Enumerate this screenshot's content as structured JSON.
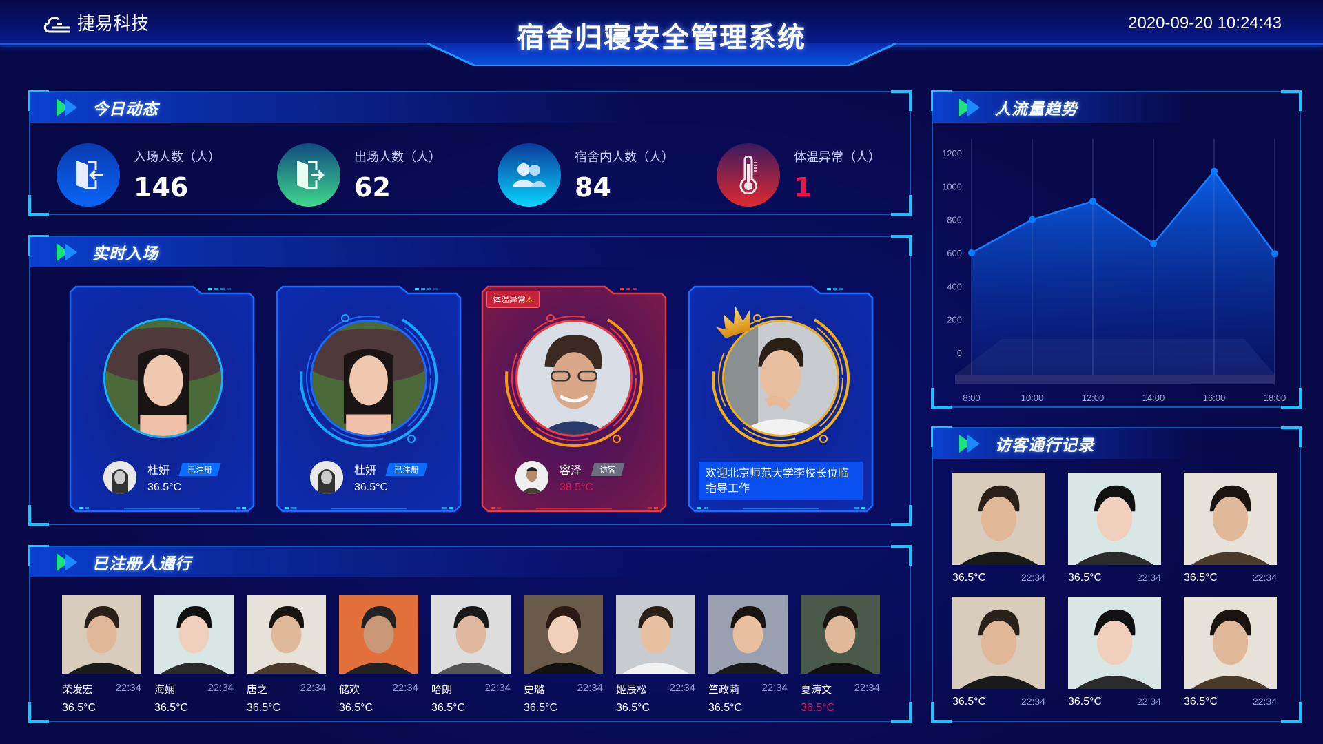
{
  "header": {
    "logo_text": "捷易科技",
    "title": "宿舍归寝安全管理系统",
    "datetime": "2020-09-20 10:24:43"
  },
  "colors": {
    "accent": "#0a5cf0",
    "corner": "#12c6ff",
    "alert": "#e8194a",
    "registered_badge": "#0a6cff",
    "visitor_badge": "#6b6e80",
    "gold": "#f5b10f"
  },
  "today": {
    "title": "今日动态",
    "stats": [
      {
        "label": "入场人数（人）",
        "value": "146",
        "icon": "door-enter-icon"
      },
      {
        "label": "出场人数（人）",
        "value": "62",
        "icon": "door-exit-icon"
      },
      {
        "label": "宿舍内人数（人）",
        "value": "84",
        "icon": "users-icon"
      },
      {
        "label": "体温异常（人）",
        "value": "1",
        "icon": "thermometer-icon"
      }
    ]
  },
  "realtime": {
    "title": "实时入场",
    "cards": [
      {
        "name": "杜妍",
        "badge": "已注册",
        "temp": "36.5°C",
        "status": "normal"
      },
      {
        "name": "杜妍",
        "badge": "已注册",
        "temp": "36.5°C",
        "status": "normal"
      },
      {
        "name": "容泽",
        "badge": "访客",
        "temp": "38.5°C",
        "status": "alert",
        "alert_label": "体温异常"
      },
      {
        "status": "vip",
        "welcome": "欢迎北京师范大学李校长位临指导工作"
      }
    ]
  },
  "registered": {
    "title": "已注册人通行",
    "items": [
      {
        "name": "荣发宏",
        "time": "22:34",
        "temp": "36.5°C"
      },
      {
        "name": "海娴",
        "time": "22:34",
        "temp": "36.5°C"
      },
      {
        "name": "唐之",
        "time": "22:34",
        "temp": "36.5°C"
      },
      {
        "name": "储欢",
        "time": "22:34",
        "temp": "36.5°C"
      },
      {
        "name": "哈朗",
        "time": "22:34",
        "temp": "36.5°C"
      },
      {
        "name": "史璐",
        "time": "22:34",
        "temp": "36.5°C"
      },
      {
        "name": "姬辰松",
        "time": "22:34",
        "temp": "36.5°C"
      },
      {
        "name": "竺政莉",
        "time": "22:34",
        "temp": "36.5°C"
      },
      {
        "name": "夏涛文",
        "time": "22:34",
        "temp": "36.5°C",
        "alert": true
      }
    ]
  },
  "trend": {
    "title": "人流量趋势"
  },
  "visitors": {
    "title": "访客通行记录",
    "items": [
      {
        "temp": "36.5°C",
        "time": "22:34"
      },
      {
        "temp": "36.5°C",
        "time": "22:34"
      },
      {
        "temp": "36.5°C",
        "time": "22:34"
      },
      {
        "temp": "36.5°C",
        "time": "22:34"
      },
      {
        "temp": "36.5°C",
        "time": "22:34"
      },
      {
        "temp": "36.5°C",
        "time": "22:34"
      }
    ]
  },
  "chart_data": {
    "type": "area",
    "title": "人流量趋势",
    "categories": [
      "8:00",
      "10:00",
      "12:00",
      "14:00",
      "16:00",
      "18:00"
    ],
    "values": [
      600,
      800,
      910,
      655,
      1090,
      595
    ],
    "yticks": [
      0,
      200,
      400,
      600,
      800,
      1000,
      1200
    ],
    "ylim": [
      0,
      1200
    ],
    "xlabel": "",
    "ylabel": "",
    "grid": "vertical"
  }
}
